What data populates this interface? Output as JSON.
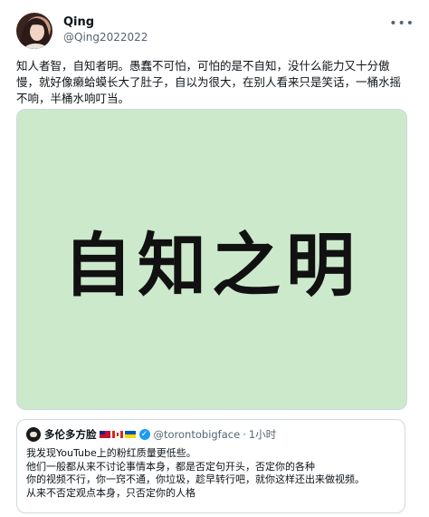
{
  "author": {
    "display_name": "Qing",
    "handle": "@Qing2022022"
  },
  "more_icon": "more-horizontal-icon",
  "tweet_text": "知人者智，自知者明。愚蠢不可怕，可怕的是不自知，没什么能力又十分傲慢，就好像癞蛤蟆长大了肚子，自以为很大，在别人看来只是笑话，一桶水摇不响，半桶水响叮当。",
  "media": {
    "caption": "自知之明",
    "background": "#cce9cc"
  },
  "quote": {
    "display_name": "多伦多方脸",
    "flags": [
      "taiwan-flag",
      "canada-flag",
      "ukraine-flag"
    ],
    "verified_icon": "verified-badge-icon",
    "handle": "@torontobigface",
    "dot": "·",
    "time": "1小时",
    "lines": [
      "我发现YouTube上的粉红质量更低些。",
      "他们一般都从来不讨论事情本身，都是否定句开头，否定你的各种",
      "你的视频不行，你一窍不通，你垃圾，趁早转行吧，就你这样还出来做视频。",
      "从来不否定观点本身，只否定你的人格"
    ]
  },
  "colors": {
    "text": "#0f1419",
    "secondary": "#536471",
    "border": "#cfd9de",
    "verified": "#1d9bf0"
  }
}
